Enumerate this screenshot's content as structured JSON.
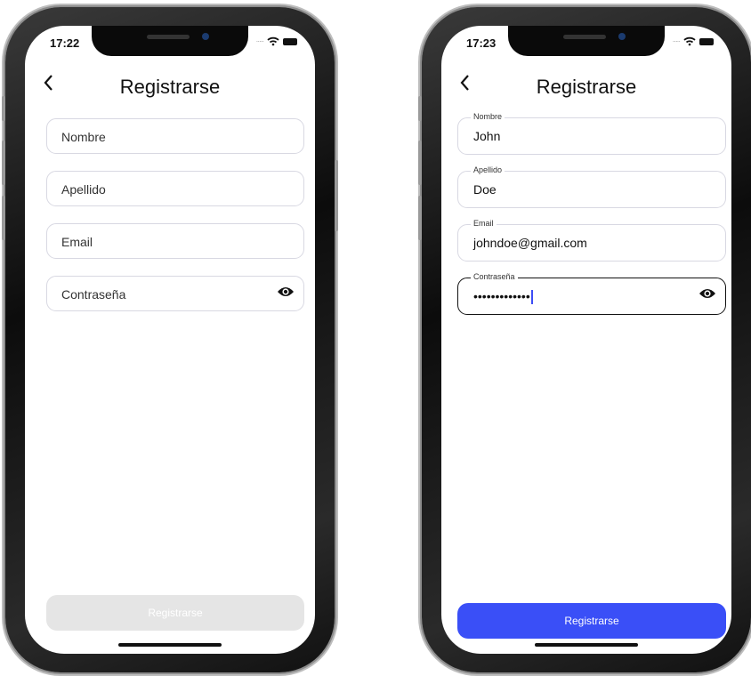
{
  "screens": [
    {
      "status_time": "17:22",
      "title": "Registrarse",
      "fields": [
        {
          "label": "Nombre",
          "value": ""
        },
        {
          "label": "Apellido",
          "value": ""
        },
        {
          "label": "Email",
          "value": ""
        },
        {
          "label": "Contraseña",
          "value": ""
        }
      ],
      "submit_label": "Registrarse",
      "submit_state": "disabled"
    },
    {
      "status_time": "17:23",
      "title": "Registrarse",
      "fields": [
        {
          "label": "Nombre",
          "value": "John"
        },
        {
          "label": "Apellido",
          "value": "Doe"
        },
        {
          "label": "Email",
          "value": "johndoe@gmail.com"
        },
        {
          "label": "Contraseña",
          "value": "•••••••••••••"
        }
      ],
      "submit_label": "Registrarse",
      "submit_state": "enabled"
    }
  ],
  "icons": {
    "back": "chevron-left-icon",
    "password_toggle": "eye-icon",
    "wifi": "wifi-icon",
    "battery": "battery-icon"
  },
  "colors": {
    "accent": "#3a4ff7",
    "disabled_button": "#e5e5e5"
  }
}
